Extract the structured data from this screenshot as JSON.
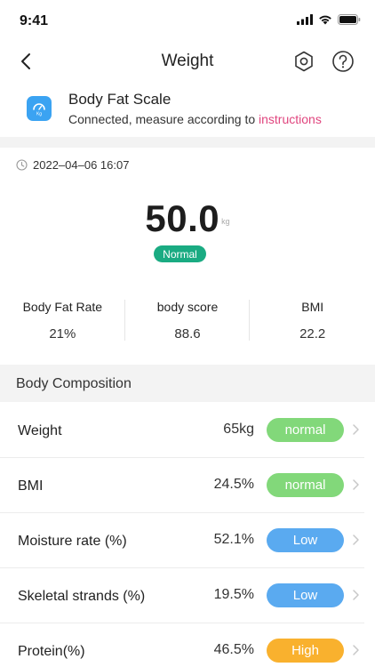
{
  "status_bar": {
    "time": "9:41"
  },
  "nav": {
    "title": "Weight"
  },
  "device": {
    "name": "Body Fat Scale",
    "status_prefix": "Connected, measure according to ",
    "status_link": "instructions",
    "icon_text": "Kg"
  },
  "record": {
    "timestamp": "2022–04–06 16:07"
  },
  "weight": {
    "value": "50.0",
    "unit": "kg",
    "status": "Normal",
    "status_color": "#1aab82"
  },
  "metrics": [
    {
      "label": "Body Fat Rate",
      "value": "21%"
    },
    {
      "label": "body score",
      "value": "88.6"
    },
    {
      "label": "BMI",
      "value": "22.2"
    }
  ],
  "composition": {
    "title": "Body Composition",
    "rows": [
      {
        "name": "Weight",
        "value": "65kg",
        "badge": "normal",
        "badge_color": "#82d87a"
      },
      {
        "name": "BMI",
        "value": "24.5%",
        "badge": "normal",
        "badge_color": "#82d87a"
      },
      {
        "name": "Moisture rate (%)",
        "value": "52.1%",
        "badge": "Low",
        "badge_color": "#5aaaf0"
      },
      {
        "name": "Skeletal strands (%)",
        "value": "19.5%",
        "badge": "Low",
        "badge_color": "#5aaaf0"
      },
      {
        "name": "Protein(%)",
        "value": "46.5%",
        "badge": "High",
        "badge_color": "#f9b12e"
      }
    ]
  }
}
